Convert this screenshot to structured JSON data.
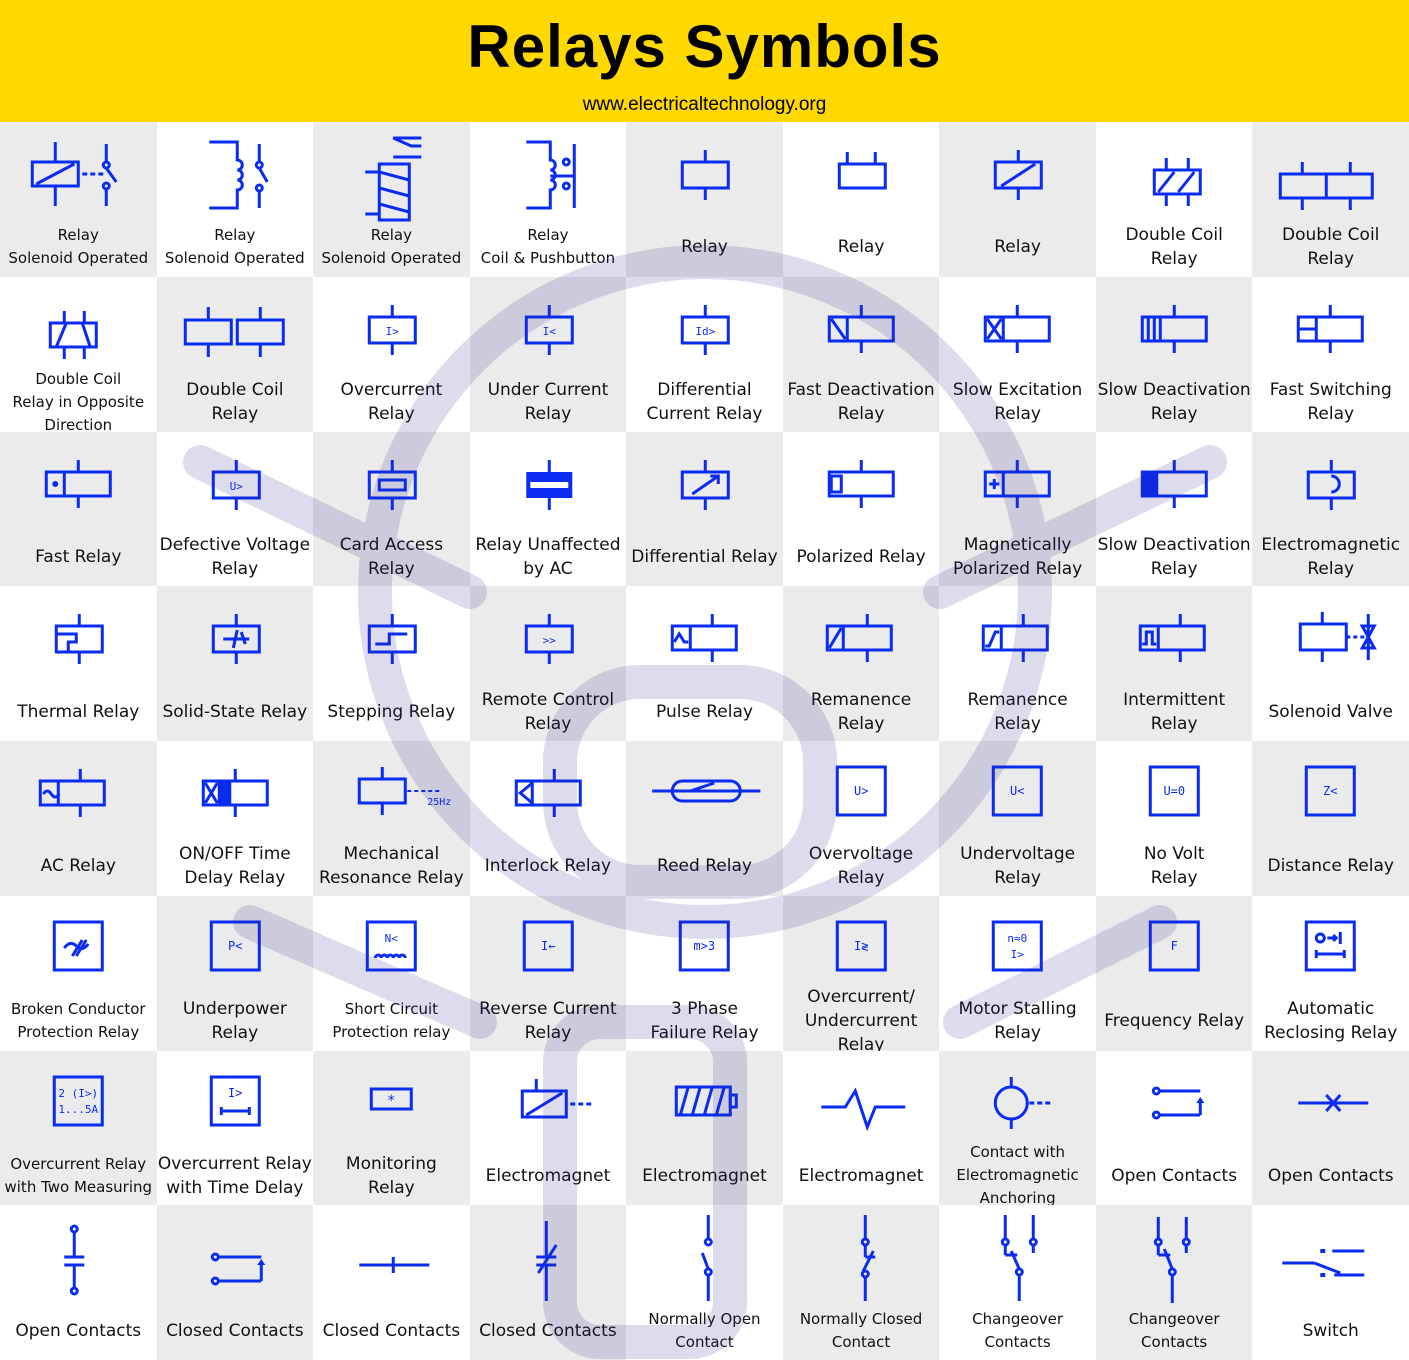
{
  "header": {
    "title": "Relays Symbols",
    "url": "www.electricaltechnology.org"
  },
  "colors": {
    "banner": "#FFD800",
    "symbol": "#0A2BF0",
    "cell_gray": "#EBEBEB",
    "cell_white": "#FFFFFF"
  },
  "cells": [
    {
      "label": "Relay\nSolenoid Operated",
      "symbol": "relay-switch",
      "small": true
    },
    {
      "label": "Relay\nSolenoid Operated",
      "symbol": "inductor-switch",
      "small": true
    },
    {
      "label": "Relay\nSolenoid Operated",
      "symbol": "solenoid-coil",
      "small": true
    },
    {
      "label": "Relay\nCoil & Pushbutton",
      "symbol": "inductor-pushbutton",
      "small": true
    },
    {
      "label": "Relay",
      "symbol": "box"
    },
    {
      "label": "Relay",
      "symbol": "box-top"
    },
    {
      "label": "Relay",
      "symbol": "box-slash"
    },
    {
      "label": "Double Coil\nRelay",
      "symbol": "box-double-slash"
    },
    {
      "label": "Double Coil\nRelay",
      "symbol": "box-wide-split"
    },
    {
      "label": "Double Coil\nRelay in Opposite\nDirection",
      "symbol": "box-opposite",
      "small": true
    },
    {
      "label": "Double Coil\nRelay",
      "symbol": "two-boxes"
    },
    {
      "label": "Overcurrent\nRelay",
      "symbol": "box-text",
      "text": "I>"
    },
    {
      "label": "Under Current\nRelay",
      "symbol": "box-text",
      "text": "I<"
    },
    {
      "label": "Differential\nCurrent Relay",
      "symbol": "box-text",
      "text": "Id>"
    },
    {
      "label": "Fast Deactivation\nRelay",
      "symbol": "box-left-slash"
    },
    {
      "label": "Slow Excitation\nRelay",
      "symbol": "box-left-x"
    },
    {
      "label": "Slow Deactivation\nRelay",
      "symbol": "box-left-bars"
    },
    {
      "label": "Fast Switching\nRelay",
      "symbol": "box-left-h"
    },
    {
      "label": "Fast Relay",
      "symbol": "box-left-dot"
    },
    {
      "label": "Defective Voltage\nRelay",
      "symbol": "box-text",
      "text": "U>"
    },
    {
      "label": "Card Access\nRelay",
      "symbol": "box-card"
    },
    {
      "label": "Relay Unaffected\nby AC",
      "symbol": "box-thick"
    },
    {
      "label": "Differential Relay",
      "symbol": "box-arrow"
    },
    {
      "label": "Polarized Relay",
      "symbol": "box-left-fill-small"
    },
    {
      "label": "Magnetically\nPolarized Relay",
      "symbol": "box-left-plus"
    },
    {
      "label": "Slow Deactivation\nRelay",
      "symbol": "box-left-fill"
    },
    {
      "label": "Electromagnetic\nRelay",
      "symbol": "box-semicircle"
    },
    {
      "label": "Thermal Relay",
      "symbol": "box-thermal"
    },
    {
      "label": "Solid-State Relay",
      "symbol": "box-transistor"
    },
    {
      "label": "Stepping Relay",
      "symbol": "box-step"
    },
    {
      "label": "Remote Control\nRelay",
      "symbol": "box-text",
      "text": ">>"
    },
    {
      "label": "Pulse Relay",
      "symbol": "box-left-pulse"
    },
    {
      "label": "Remanence\nRelay",
      "symbol": "box-left-slash-wide"
    },
    {
      "label": "Remanence\nRelay",
      "symbol": "box-left-step"
    },
    {
      "label": "Intermittent\nRelay",
      "symbol": "box-left-square-pulse"
    },
    {
      "label": "Solenoid Valve",
      "symbol": "box-valve"
    },
    {
      "label": "AC Relay",
      "symbol": "box-left-tilde"
    },
    {
      "label": "ON/OFF Time\nDelay Relay",
      "symbol": "box-x-fill"
    },
    {
      "label": "Mechanical\nResonance Relay",
      "symbol": "box-resonance",
      "text": "25Hz"
    },
    {
      "label": "Interlock Relay",
      "symbol": "box-left-k"
    },
    {
      "label": "Reed Relay",
      "symbol": "reed"
    },
    {
      "label": "Overvoltage\nRelay",
      "symbol": "square-text",
      "text": "U>"
    },
    {
      "label": "Undervoltage\nRelay",
      "symbol": "square-text",
      "text": "U<"
    },
    {
      "label": "No Volt\nRelay",
      "symbol": "square-text",
      "text": "U=0"
    },
    {
      "label": "Distance Relay",
      "symbol": "square-text",
      "text": "Z<"
    },
    {
      "label": "Broken Conductor\nProtection Relay",
      "symbol": "square-broken",
      "small": true
    },
    {
      "label": "Underpower\nRelay",
      "symbol": "square-text",
      "text": "P<"
    },
    {
      "label": "Short Circuit\nProtection relay",
      "symbol": "square-text-coil",
      "text": "N<",
      "small": true
    },
    {
      "label": "Reverse Current\nRelay",
      "symbol": "square-text",
      "text": "I←"
    },
    {
      "label": "3 Phase\nFailure Relay",
      "symbol": "square-text",
      "text": "m>3"
    },
    {
      "label": "Overcurrent/\nUndercurrent\nRelay",
      "symbol": "square-text",
      "text": "I≷"
    },
    {
      "label": "Motor Stalling\nRelay",
      "symbol": "square-text-2",
      "text": "n≈0",
      "text2": "I>"
    },
    {
      "label": "Frequency Relay",
      "symbol": "square-text",
      "text": "F"
    },
    {
      "label": "Automatic\nReclosing Relay",
      "symbol": "square-reclose",
      "text": "O→I"
    },
    {
      "label": "Overcurrent Relay\nwith Two Measuring",
      "symbol": "square-text-2",
      "text": "2 (I>)",
      "text2": "1...5A",
      "small": true
    },
    {
      "label": "Overcurrent Relay\nwith Time Delay",
      "symbol": "square-delay",
      "text": "I>"
    },
    {
      "label": "Monitoring\nRelay",
      "symbol": "box-star",
      "text": "*"
    },
    {
      "label": "Electromagnet",
      "symbol": "magnet-slash"
    },
    {
      "label": "Electromagnet",
      "symbol": "magnet-coil"
    },
    {
      "label": "Electromagnet",
      "symbol": "magnet-zigzag"
    },
    {
      "label": "Contact with\nElectromagnetic\nAnchoring",
      "symbol": "circle-dash",
      "small": true
    },
    {
      "label": "Open Contacts",
      "symbol": "open-contacts-arrow"
    },
    {
      "label": "Open Contacts",
      "symbol": "cross-line"
    },
    {
      "label": "Open Contacts",
      "symbol": "capacitor"
    },
    {
      "label": "Closed Contacts",
      "symbol": "closed-contacts-arrow"
    },
    {
      "label": "Closed Contacts",
      "symbol": "tick-line"
    },
    {
      "label": "Closed Contacts",
      "symbol": "variable-cap"
    },
    {
      "label": "Normally Open\nContact",
      "symbol": "no-contact",
      "small": true
    },
    {
      "label": "Normally Closed\nContact",
      "symbol": "nc-contact",
      "small": true
    },
    {
      "label": "Changeover\nContacts",
      "symbol": "changeover",
      "small": true
    },
    {
      "label": "Changeover\nContacts",
      "symbol": "changeover-2",
      "small": true
    },
    {
      "label": "Switch",
      "symbol": "switch"
    }
  ]
}
